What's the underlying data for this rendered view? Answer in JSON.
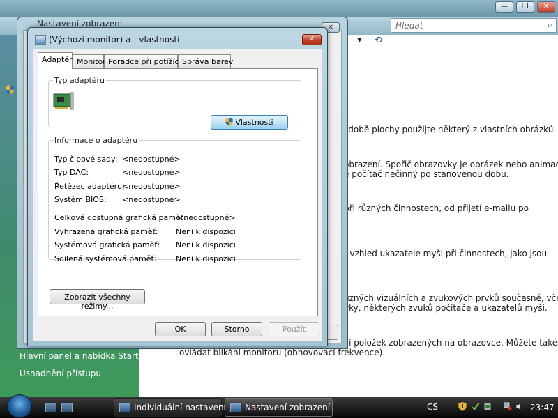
{
  "background_window": {
    "title": "Nastavení zobrazení",
    "search_placeholder": "Hledat",
    "sidebar_links": [
      "Hlavní panel a nabídka Start",
      "Usnadnění přístupu"
    ],
    "content_lines": [
      "zdobě plochy použijte některý z vlastních obrázků.",
      "obrazení. Spořič obrazovky je obrázek nebo animace,",
      "e počítač nečinný po stanovenou dobu.",
      "při různých činnostech, od přijetí e-mailu po",
      "t vzhled ukazatele myši při činnostech, jako jsou",
      "ůzných vizuálních a zvukových prvků současně, včetně",
      "vky, některých zvuků počítače a ukazatelů myši.",
      "ví položek zobrazených na obrazovce. Můžete také",
      "ovládat blikání monitoru (obnovovací frekvence)."
    ]
  },
  "outer_window": {
    "title": "Nastavení zobrazení"
  },
  "dialog": {
    "title": "(Výchozí monitor) a  - vlastnosti",
    "close_glyph": "✕",
    "tabs": [
      {
        "label": "Adaptér",
        "active": true
      },
      {
        "label": "Monitor",
        "active": false
      },
      {
        "label": "Poradce při potížích",
        "active": false
      },
      {
        "label": "Správa barev",
        "active": false
      }
    ],
    "adapter_type": {
      "legend": "Typ adaptéru",
      "properties_button": "Vlastnosti"
    },
    "adapter_info": {
      "legend": "Informace o adaptéru",
      "rows": [
        {
          "label": "Typ čipové sady:",
          "value": "<nedostupné>"
        },
        {
          "label": "Typ DAC:",
          "value": "<nedostupné>"
        },
        {
          "label": "Řetězec adaptéru:",
          "value": "<nedostupné>"
        },
        {
          "label": "Systém BIOS:",
          "value": "<nedostupné>"
        }
      ],
      "memory_rows": [
        {
          "label": "Celková dostupná grafická paměť:",
          "value": "<nedostupné>"
        },
        {
          "label": "Vyhrazená grafická paměť:",
          "value": "Není k dispozici"
        },
        {
          "label": "Systémová grafická paměť:",
          "value": "Není k dispozici"
        },
        {
          "label": "Sdílená systémová paměť:",
          "value": "Není k dispozici"
        }
      ]
    },
    "list_modes_button": "Zobrazit všechny režimy...",
    "ok_button": "OK",
    "cancel_button": "Storno",
    "apply_button": "Použít"
  },
  "taskbar": {
    "items": [
      {
        "label": "Individuální nastavení"
      },
      {
        "label": "Nastavení zobrazení"
      }
    ],
    "language": "CS",
    "clock": "23:47"
  },
  "colors": {
    "sidebar_top": "#5b8ea3",
    "sidebar_bottom": "#3e9a5a",
    "close_button": "#c2402a",
    "default_button_border": "#3c7fb1"
  }
}
